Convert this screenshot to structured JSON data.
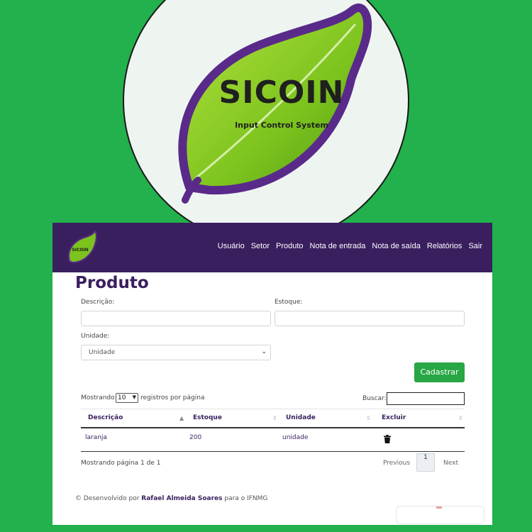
{
  "logo": {
    "title": "SICOIN",
    "subtitle": "Input Control System"
  },
  "nav": {
    "items": [
      "Usuário",
      "Setor",
      "Produto",
      "Nota de entrada",
      "Nota de saída",
      "Relatórios",
      "Sair"
    ]
  },
  "page": {
    "title": "Produto"
  },
  "form": {
    "descricao_label": "Descrição:",
    "descricao_value": "",
    "estoque_label": "Estoque:",
    "estoque_value": "",
    "unidade_label": "Unidade:",
    "unidade_value": "Unidade",
    "submit_label": "Cadastrar"
  },
  "table_controls": {
    "show_prefix": "Mostrando",
    "page_length": "10",
    "show_suffix": "registros por página",
    "search_label": "Buscar:",
    "search_value": ""
  },
  "table": {
    "headers": [
      "Descrição",
      "Estoque",
      "Unidade",
      "Excluir"
    ],
    "rows": [
      {
        "descricao": "laranja",
        "estoque": "200",
        "unidade": "unidade",
        "excluir_icon": "trash-icon"
      }
    ]
  },
  "pagination": {
    "info": "Mostrando página 1 de 1",
    "previous": "Previous",
    "current": "1",
    "next": "Next"
  },
  "footer": {
    "prefix": "© Desenvolvido por",
    "author": "Rafael Almeida Soares",
    "suffix": "para o IFNMG"
  },
  "colors": {
    "background": "#22b14c",
    "navbar": "#3a1f5f",
    "accent": "#28a745",
    "leaf": "#7cc31e",
    "leaf_outline": "#5a2a8a"
  }
}
